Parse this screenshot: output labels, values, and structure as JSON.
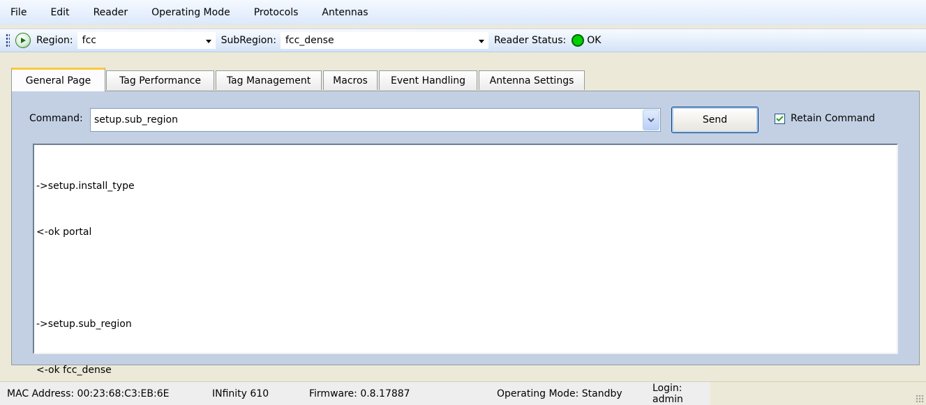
{
  "menu": [
    "File",
    "Edit",
    "Reader",
    "Operating Mode",
    "Protocols",
    "Antennas"
  ],
  "toolbar": {
    "region_label": "Region:",
    "region_value": "fcc",
    "subregion_label": "SubRegion:",
    "subregion_value": "fcc_dense",
    "status_label": "Reader Status:",
    "status_value": "OK",
    "status_color": "#00d000"
  },
  "tabs": [
    "General Page",
    "Tag Performance",
    "Tag Management",
    "Macros",
    "Event Handling",
    "Antenna Settings"
  ],
  "active_tab": "General Page",
  "command": {
    "label": "Command:",
    "value": "setup.sub_region",
    "send_label": "Send",
    "retain_label": "Retain Command",
    "retain_checked": true
  },
  "output": {
    "lines": [
      "->setup.install_type",
      "<-ok portal",
      "",
      "->setup.sub_region",
      "<-ok fcc_dense"
    ]
  },
  "statusbar": {
    "mac": "MAC Address: 00:23:68:C3:EB:6E",
    "model": "INfinity 610",
    "firmware": "Firmware: 0.8.17887",
    "mode": "Operating Mode: Standby",
    "login": "Login: admin"
  }
}
